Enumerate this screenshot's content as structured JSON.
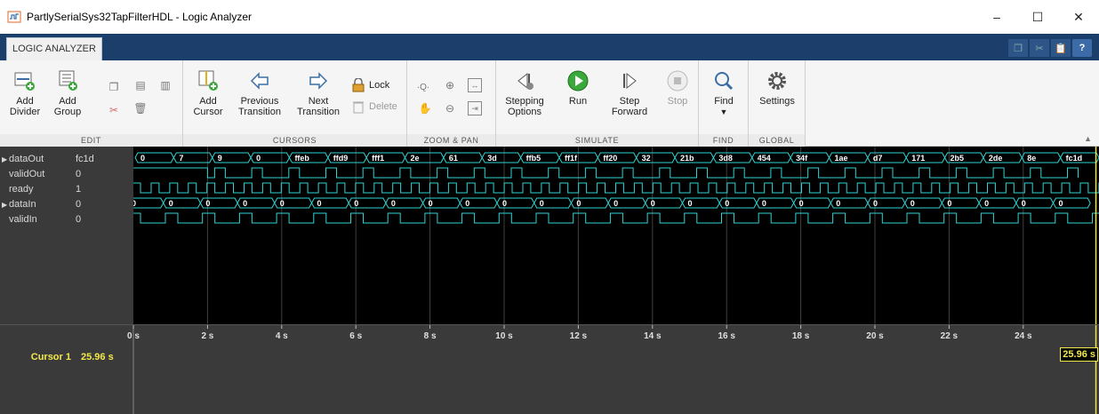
{
  "window": {
    "title": "PartlySerialSys32TapFilterHDL - Logic Analyzer",
    "minimize": "–",
    "maximize": "☐",
    "close": "✕"
  },
  "ribbon": {
    "tab": "LOGIC ANALYZER",
    "help": "?"
  },
  "toolstrip": {
    "edit": {
      "label": "EDIT",
      "add_divider": [
        "Add",
        "Divider"
      ],
      "add_group": [
        "Add",
        "Group"
      ]
    },
    "cursors": {
      "label": "CURSORS",
      "add_cursor": [
        "Add",
        "Cursor"
      ],
      "previous_transition": [
        "Previous",
        "Transition"
      ],
      "next_transition": [
        "Next",
        "Transition"
      ],
      "lock": "Lock",
      "delete": "Delete"
    },
    "zoom_pan": {
      "label": "ZOOM & PAN"
    },
    "simulate": {
      "label": "SIMULATE",
      "stepping_options": [
        "Stepping",
        "Options"
      ],
      "run": "Run",
      "step_forward": [
        "Step",
        "Forward"
      ],
      "stop": "Stop"
    },
    "find": {
      "label": "FIND",
      "find": "Find"
    },
    "global": {
      "label": "GLOBAL",
      "settings": "Settings"
    }
  },
  "signals": [
    {
      "name": "dataOut",
      "value": "fc1d",
      "kind": "bus",
      "expandable": true,
      "values": [
        "0",
        "7",
        "9",
        "0",
        "ffeb",
        "ffd9",
        "fff1",
        "2e",
        "61",
        "3d",
        "ffb5",
        "ff1f",
        "ff20",
        "32",
        "21b",
        "3d8",
        "454",
        "34f",
        "1ae",
        "d7",
        "171",
        "2b5",
        "2de",
        "8e",
        "fc1d"
      ]
    },
    {
      "name": "validOut",
      "value": "0",
      "kind": "bit",
      "pulses": "out"
    },
    {
      "name": "ready",
      "value": "1",
      "kind": "bit",
      "pulses": "ready"
    },
    {
      "name": "dataIn",
      "value": "0",
      "kind": "bus",
      "expandable": true,
      "values": [
        "0"
      ]
    },
    {
      "name": "validIn",
      "value": "0",
      "kind": "bit",
      "pulses": "in"
    }
  ],
  "time_axis": {
    "ticks": [
      "0 s",
      "2 s",
      "4 s",
      "6 s",
      "8 s",
      "10 s",
      "12 s",
      "14 s",
      "16 s",
      "18 s",
      "20 s",
      "22 s",
      "24 s"
    ],
    "tick_values": [
      0,
      2,
      4,
      6,
      8,
      10,
      12,
      14,
      16,
      18,
      20,
      22,
      24
    ],
    "max_s": 25.96
  },
  "cursor": {
    "name": "Cursor 1",
    "time": "25.96 s",
    "time_s": 25.96
  },
  "colors": {
    "wave": "#2fd4d4",
    "cursor": "#f2e84a",
    "ribbon_bg": "#1c3e6a"
  }
}
